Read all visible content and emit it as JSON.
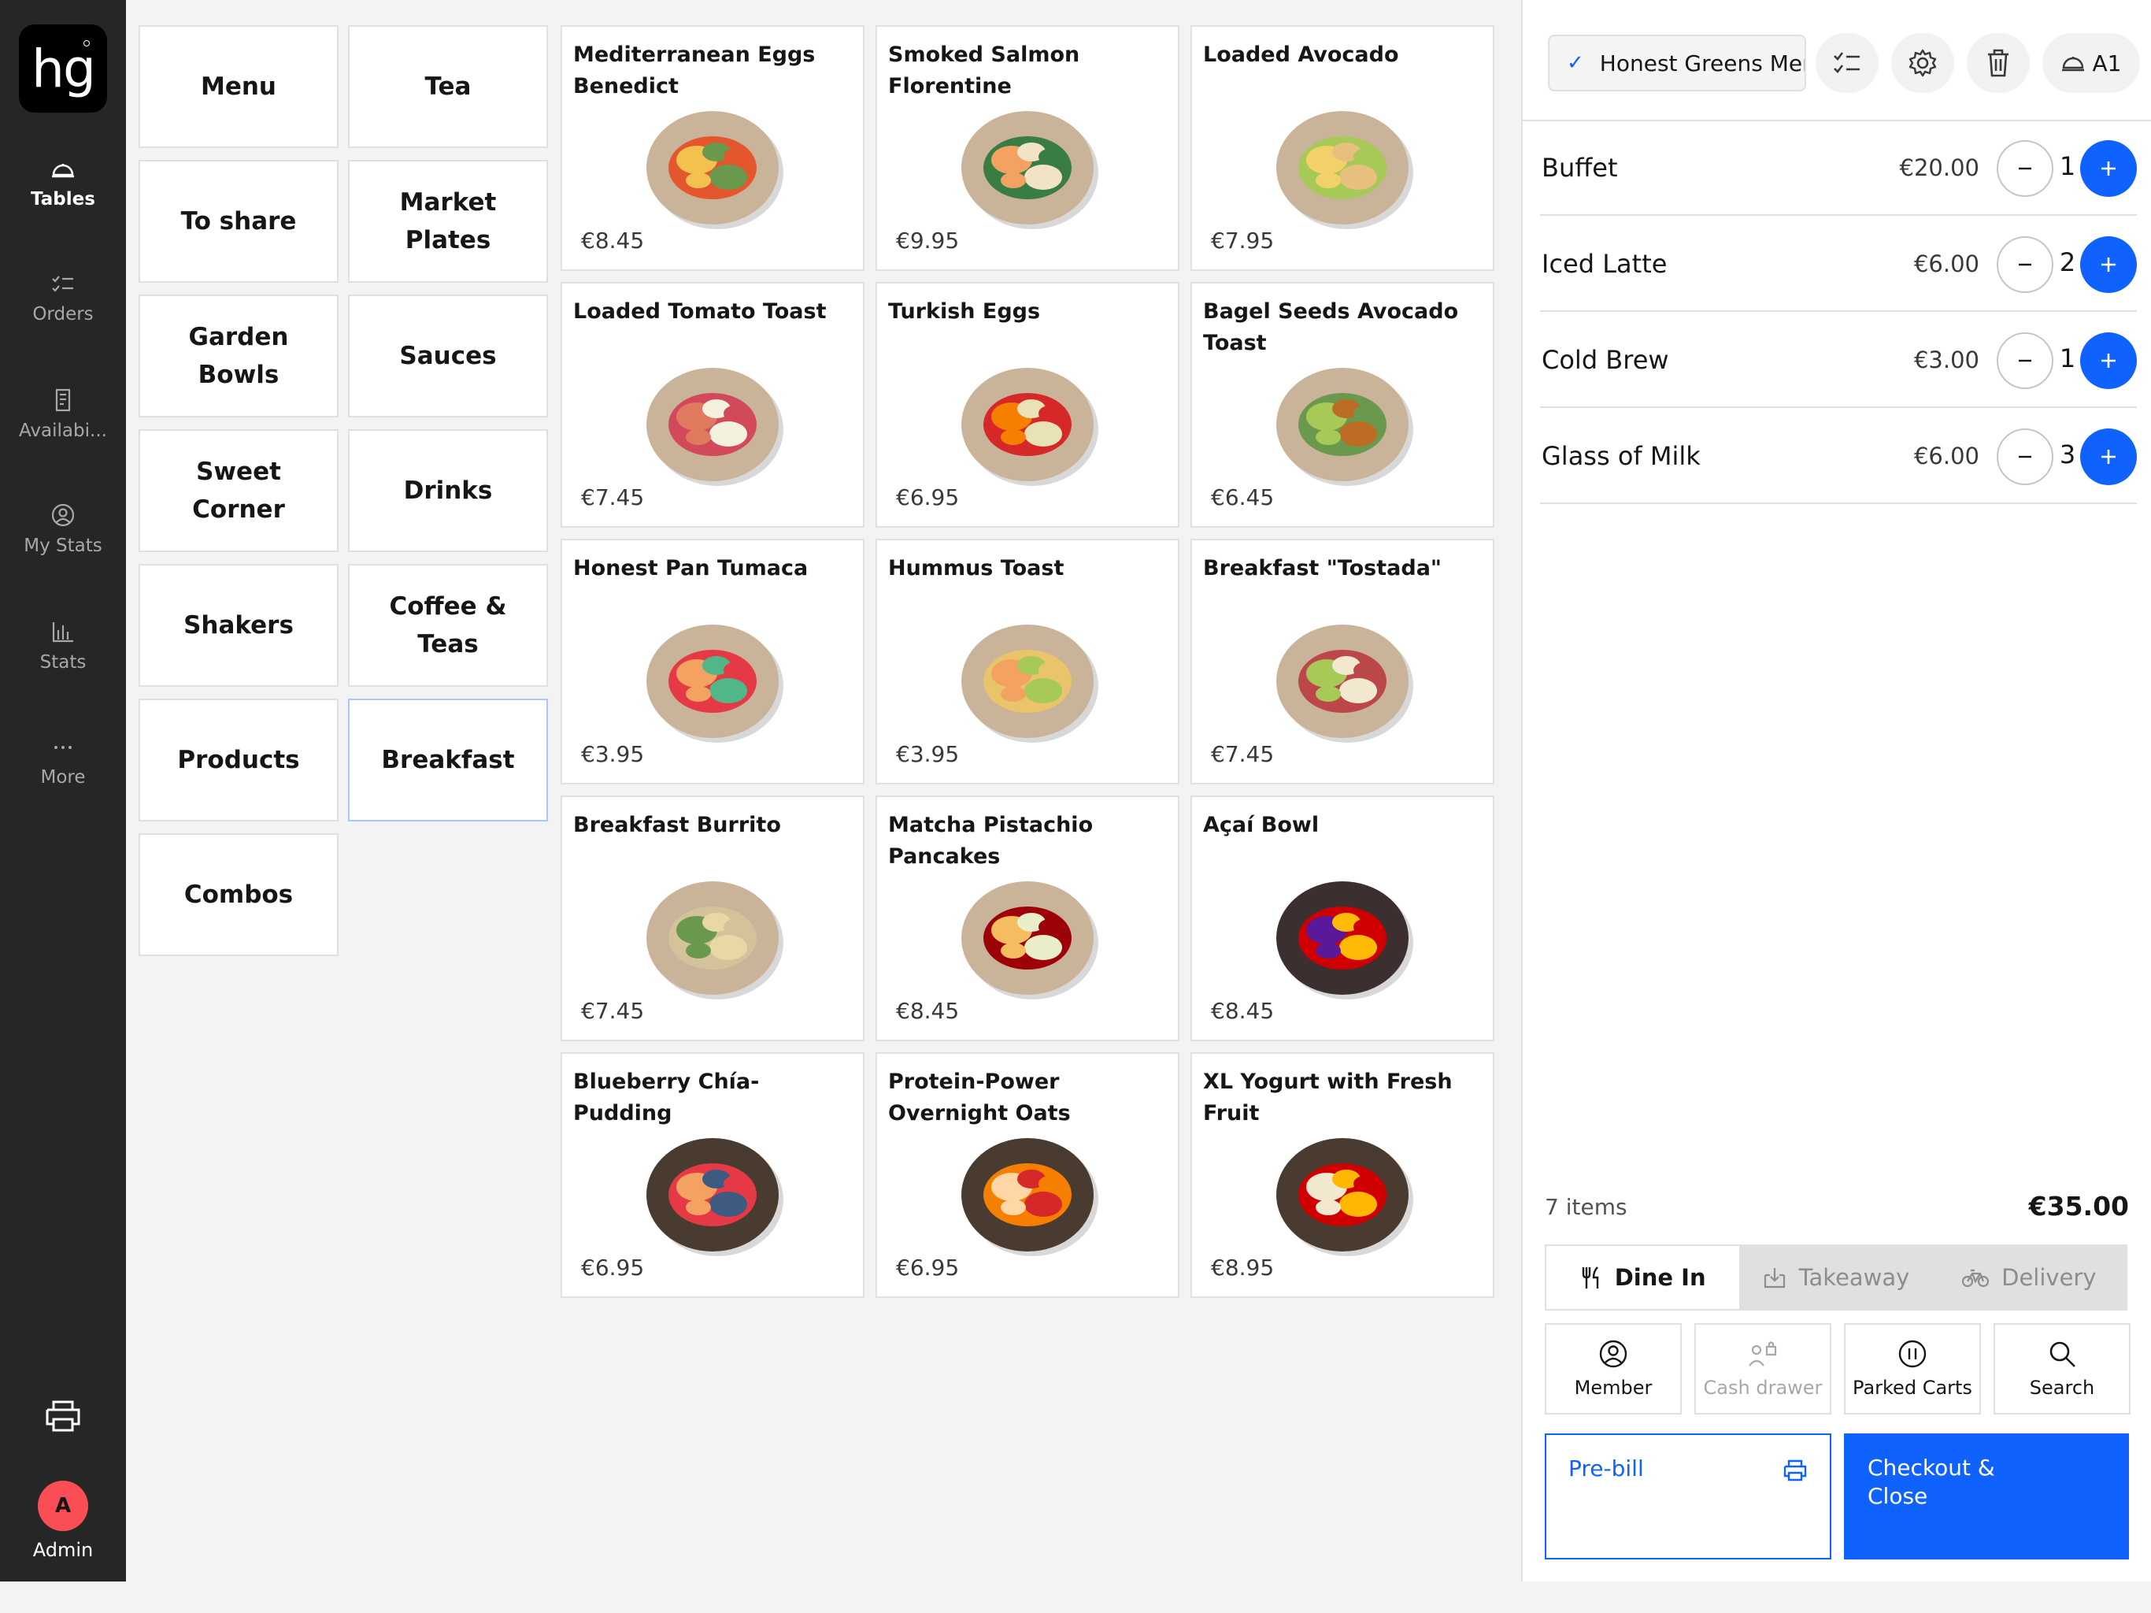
{
  "sidebar": {
    "logo": "hg",
    "items": [
      {
        "label": "Tables",
        "icon": "tables-icon",
        "active": true
      },
      {
        "label": "Orders",
        "icon": "orders-icon"
      },
      {
        "label": "Availabi...",
        "icon": "availability-icon"
      },
      {
        "label": "My Stats",
        "icon": "user-circle-icon"
      },
      {
        "label": "Stats",
        "icon": "bar-chart-icon"
      },
      {
        "label": "More",
        "icon": "more-icon"
      }
    ],
    "admin_initial": "A",
    "admin_label": "Admin"
  },
  "categories": [
    {
      "label": "Menu"
    },
    {
      "label": "Tea"
    },
    {
      "label": "To share"
    },
    {
      "label": "Market Plates"
    },
    {
      "label": "Garden Bowls"
    },
    {
      "label": "Sauces"
    },
    {
      "label": "Sweet Corner"
    },
    {
      "label": "Drinks"
    },
    {
      "label": "Shakers"
    },
    {
      "label": "Coffee & Teas"
    },
    {
      "label": "Products"
    },
    {
      "label": "Breakfast",
      "selected": true
    },
    {
      "label": "Combos"
    }
  ],
  "products": [
    {
      "name": "Mediterranean Eggs Benedict",
      "price": "€8.45",
      "plate": "#c9b49a",
      "food": [
        "#e4572e",
        "#f2c14e",
        "#6a994e"
      ]
    },
    {
      "name": "Smoked Salmon Florentine",
      "price": "€9.95",
      "plate": "#c9b49a",
      "food": [
        "#3a7d44",
        "#f4a261",
        "#f1e3c4"
      ]
    },
    {
      "name": "Loaded Avocado",
      "price": "€7.95",
      "plate": "#c9b49a",
      "food": [
        "#a7c957",
        "#f2d16b",
        "#e8c07d"
      ]
    },
    {
      "name": "Loaded Tomato Toast",
      "price": "€7.45",
      "plate": "#c9b49a",
      "food": [
        "#d1495b",
        "#e07a5f",
        "#f4f1de"
      ]
    },
    {
      "name": "Turkish Eggs",
      "price": "€6.95",
      "plate": "#c9b49a",
      "food": [
        "#d62828",
        "#f77f00",
        "#eae2b7"
      ]
    },
    {
      "name": "Bagel Seeds Avocado Toast",
      "price": "€6.45",
      "plate": "#c9b49a",
      "food": [
        "#6a994e",
        "#a7c957",
        "#bc6c25"
      ]
    },
    {
      "name": "Honest Pan Tumaca",
      "price": "€3.95",
      "plate": "#c9b49a",
      "food": [
        "#e63946",
        "#f4a261",
        "#52b788"
      ]
    },
    {
      "name": "Hummus Toast",
      "price": "€3.95",
      "plate": "#c9b49a",
      "food": [
        "#e9c46a",
        "#f4a261",
        "#a7c957"
      ]
    },
    {
      "name": "Breakfast \"Tostada\"",
      "price": "€7.45",
      "plate": "#c9b49a",
      "food": [
        "#bc4749",
        "#a7c957",
        "#f2e8cf"
      ]
    },
    {
      "name": "Breakfast Burrito",
      "price": "€7.45",
      "plate": "#c9b49a",
      "food": [
        "#d4c29a",
        "#6a994e",
        "#e9d8a6"
      ]
    },
    {
      "name": "Matcha Pistachio Pancakes",
      "price": "€8.45",
      "plate": "#c9b49a",
      "food": [
        "#9d0208",
        "#f6bd60",
        "#e9edc9"
      ]
    },
    {
      "name": "Açaí Bowl",
      "price": "€8.45",
      "plate": "#3b2f2f",
      "food": [
        "#d00000",
        "#5a189a",
        "#ffba08"
      ]
    },
    {
      "name": "Blueberry Chía-Pudding",
      "price": "€6.95",
      "plate": "#4a3b30",
      "food": [
        "#e63946",
        "#f4a261",
        "#3d5a80"
      ]
    },
    {
      "name": "Protein-Power Overnight Oats",
      "price": "€6.95",
      "plate": "#4a3b30",
      "food": [
        "#f77f00",
        "#ffd6a5",
        "#d62828"
      ]
    },
    {
      "name": "XL Yogurt with Fresh Fruit",
      "price": "€8.95",
      "plate": "#4a3b30",
      "food": [
        "#d00000",
        "#f2e8cf",
        "#ffb703"
      ]
    }
  ],
  "cart": {
    "menu_name": "Honest Greens Menu",
    "table": "A1",
    "lines": [
      {
        "name": "Buffet",
        "price": "€20.00",
        "qty": "1"
      },
      {
        "name": "Iced Latte",
        "price": "€6.00",
        "qty": "2"
      },
      {
        "name": "Cold Brew",
        "price": "€3.00",
        "qty": "1"
      },
      {
        "name": "Glass of Milk",
        "price": "€6.00",
        "qty": "3"
      }
    ],
    "item_count": "7 items",
    "total": "€35.00",
    "order_types": [
      {
        "label": "Dine In",
        "icon": "fork-knife-icon",
        "active": true
      },
      {
        "label": "Takeaway",
        "icon": "takeaway-icon"
      },
      {
        "label": "Delivery",
        "icon": "bicycle-icon"
      }
    ],
    "actions": [
      {
        "label": "Member",
        "icon": "user-circle-icon"
      },
      {
        "label": "Cash drawer",
        "icon": "cash-drawer-icon",
        "disabled": true
      },
      {
        "label": "Parked Carts",
        "icon": "pause-icon"
      },
      {
        "label": "Search",
        "icon": "search-icon"
      }
    ],
    "prebill_label": "Pre-bill",
    "checkout_label_line1": "Checkout &",
    "checkout_label_line2": "Close"
  },
  "colors": {
    "accent": "#0f62fe",
    "sidebar": "#262626",
    "admin_avatar": "#fa4d56"
  }
}
